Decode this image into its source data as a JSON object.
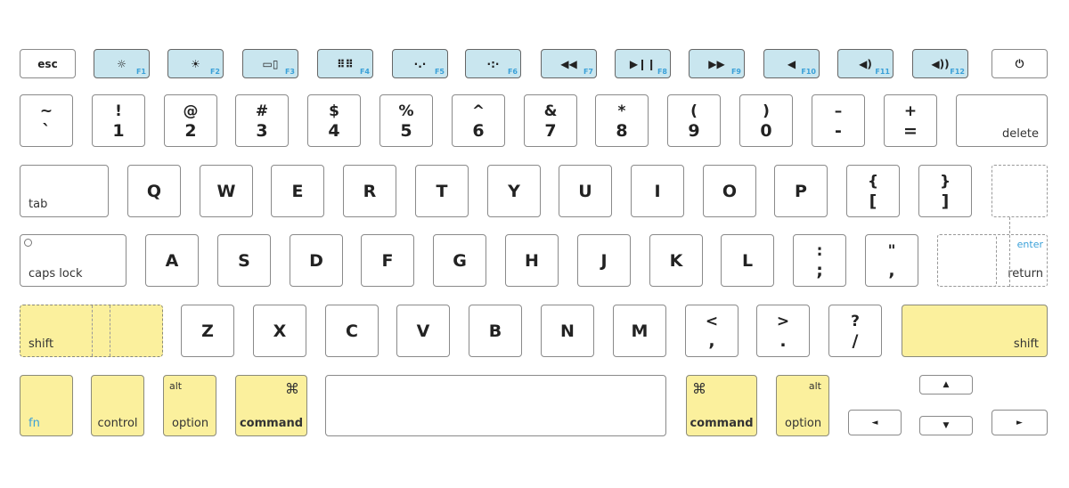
{
  "colors": {
    "function_key": "#c9e6ef",
    "modifier_key": "#fbf09d",
    "fn_label": "#3aa0d8",
    "border": "#8a8a8a"
  },
  "rows": {
    "function": [
      {
        "label": "esc"
      },
      {
        "icon": "brightness-down-icon",
        "fn": "F1"
      },
      {
        "icon": "brightness-up-icon",
        "fn": "F2"
      },
      {
        "icon": "mission-control-icon",
        "fn": "F3"
      },
      {
        "icon": "launchpad-icon",
        "fn": "F4"
      },
      {
        "icon": "keyboard-backlight-down-icon",
        "fn": "F5"
      },
      {
        "icon": "keyboard-backlight-up-icon",
        "fn": "F6"
      },
      {
        "icon": "rewind-icon",
        "fn": "F7"
      },
      {
        "icon": "play-pause-icon",
        "fn": "F8"
      },
      {
        "icon": "fast-forward-icon",
        "fn": "F9"
      },
      {
        "icon": "mute-icon",
        "fn": "F10"
      },
      {
        "icon": "volume-down-icon",
        "fn": "F11"
      },
      {
        "icon": "volume-up-icon",
        "fn": "F12"
      },
      {
        "icon": "power-icon"
      }
    ],
    "number": [
      {
        "top": "~",
        "bottom": "`"
      },
      {
        "top": "!",
        "bottom": "1"
      },
      {
        "top": "@",
        "bottom": "2"
      },
      {
        "top": "#",
        "bottom": "3"
      },
      {
        "top": "$",
        "bottom": "4"
      },
      {
        "top": "%",
        "bottom": "5"
      },
      {
        "top": "^",
        "bottom": "6"
      },
      {
        "top": "&",
        "bottom": "7"
      },
      {
        "top": "*",
        "bottom": "8"
      },
      {
        "top": "(",
        "bottom": "9"
      },
      {
        "top": ")",
        "bottom": "0"
      },
      {
        "top": "–",
        "bottom": "-"
      },
      {
        "top": "+",
        "bottom": "="
      },
      {
        "name": "delete"
      }
    ],
    "qwerty": [
      {
        "name": "tab"
      },
      {
        "label": "Q"
      },
      {
        "label": "W"
      },
      {
        "label": "E"
      },
      {
        "label": "R"
      },
      {
        "label": "T"
      },
      {
        "label": "Y"
      },
      {
        "label": "U"
      },
      {
        "label": "I"
      },
      {
        "label": "O"
      },
      {
        "label": "P"
      },
      {
        "top": "{",
        "bottom": "["
      },
      {
        "top": "}",
        "bottom": "]"
      }
    ],
    "home": [
      {
        "name": "caps lock"
      },
      {
        "label": "A"
      },
      {
        "label": "S"
      },
      {
        "label": "D"
      },
      {
        "label": "F"
      },
      {
        "label": "G"
      },
      {
        "label": "H"
      },
      {
        "label": "J"
      },
      {
        "label": "K"
      },
      {
        "label": "L"
      },
      {
        "top": ":",
        "bottom": ";"
      },
      {
        "top": "\"",
        "bottom": ","
      }
    ],
    "shift": [
      {
        "name": "shift"
      },
      {
        "label": "Z"
      },
      {
        "label": "X"
      },
      {
        "label": "C"
      },
      {
        "label": "V"
      },
      {
        "label": "B"
      },
      {
        "label": "N"
      },
      {
        "label": "M"
      },
      {
        "top": "<",
        "bottom": ","
      },
      {
        "top": ">",
        "bottom": "."
      },
      {
        "top": "?",
        "bottom": "/"
      },
      {
        "name": "shift"
      }
    ],
    "bottom": [
      {
        "name": "fn"
      },
      {
        "name": "control"
      },
      {
        "name": "option",
        "alt": "alt"
      },
      {
        "name": "command",
        "alt": "⌘"
      },
      {
        "name": ""
      },
      {
        "name": "command",
        "alt": "⌘"
      },
      {
        "name": "option",
        "alt": "alt"
      },
      {
        "arrow": "▲"
      },
      {
        "arrow": "◄"
      },
      {
        "arrow": "▼"
      },
      {
        "arrow": "►"
      }
    ]
  },
  "return_key": {
    "enter": "enter",
    "return": "return"
  }
}
